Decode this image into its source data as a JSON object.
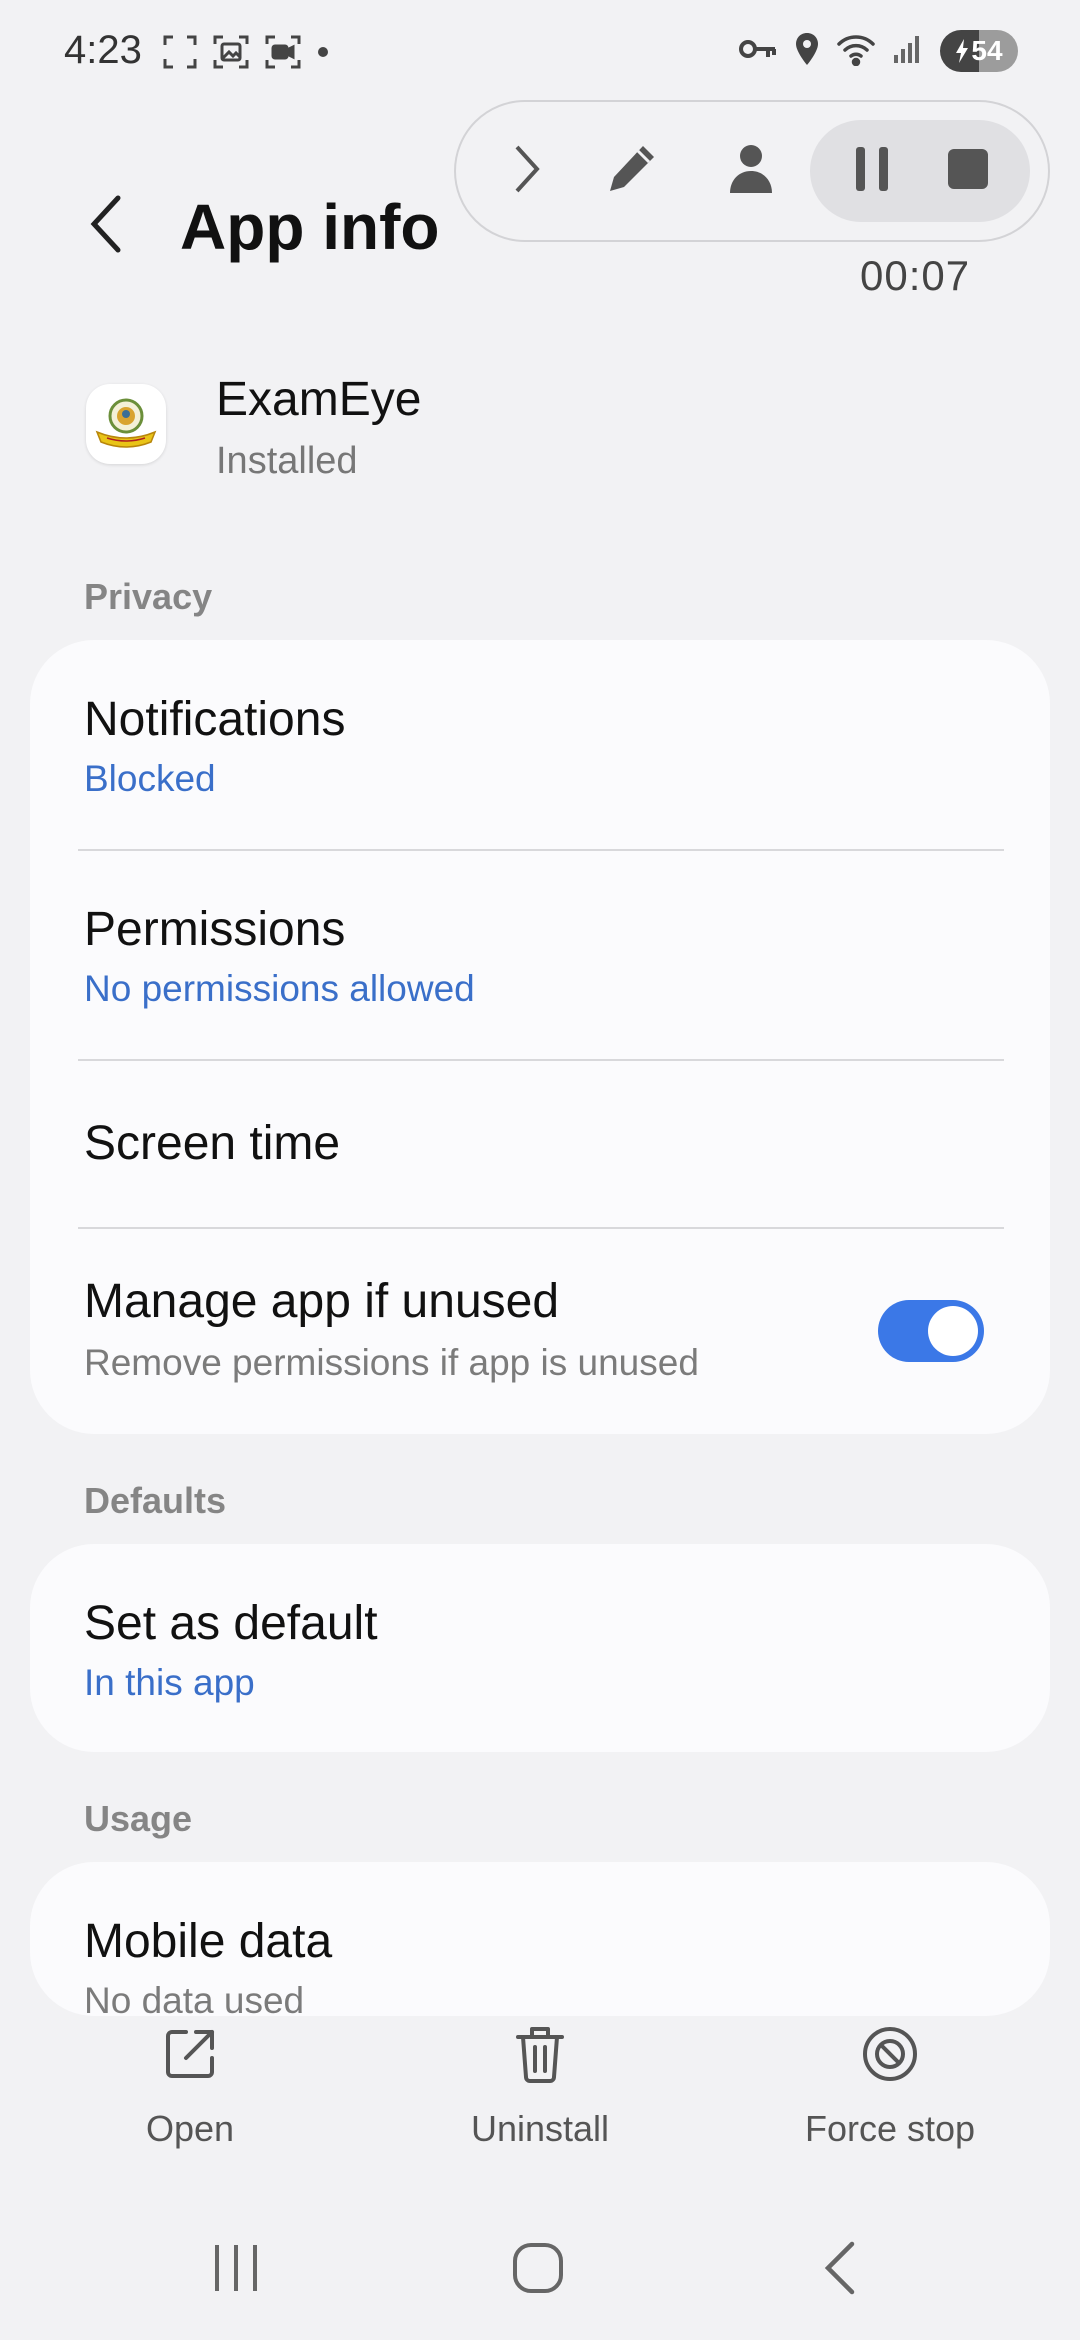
{
  "status_bar": {
    "time": "4:23",
    "battery": "54",
    "left_icons": [
      "screenshot-frame-icon",
      "gallery-capture-icon",
      "screen-record-icon",
      "dot-icon"
    ],
    "right_icons": [
      "vpn-key-icon",
      "location-icon",
      "wifi-icon",
      "signal-icon",
      "battery-charging-icon"
    ]
  },
  "recorder": {
    "timer": "00:07",
    "icons": [
      "chevron-right-icon",
      "pencil-icon",
      "person-icon",
      "pause-icon",
      "stop-icon"
    ]
  },
  "header": {
    "title": "App info"
  },
  "app": {
    "name": "ExamEye",
    "status": "Installed"
  },
  "sections": {
    "privacy": "Privacy",
    "defaults": "Defaults",
    "usage": "Usage"
  },
  "privacy_items": {
    "notifications": {
      "title": "Notifications",
      "sub": "Blocked"
    },
    "permissions": {
      "title": "Permissions",
      "sub": "No permissions allowed"
    },
    "screen_time": {
      "title": "Screen time"
    },
    "manage_unused": {
      "title": "Manage app if unused",
      "sub": "Remove permissions if app is unused",
      "enabled": true
    }
  },
  "defaults_items": {
    "set_default": {
      "title": "Set as default",
      "sub": "In this app"
    }
  },
  "usage_items": {
    "mobile_data": {
      "title": "Mobile data",
      "sub": "No data used"
    }
  },
  "actions": {
    "open": "Open",
    "uninstall": "Uninstall",
    "force_stop": "Force stop"
  },
  "colors": {
    "accent": "#3b78e7",
    "link": "#3a6fc9",
    "background": "#f2f2f4",
    "card": "#fbfbfd"
  }
}
